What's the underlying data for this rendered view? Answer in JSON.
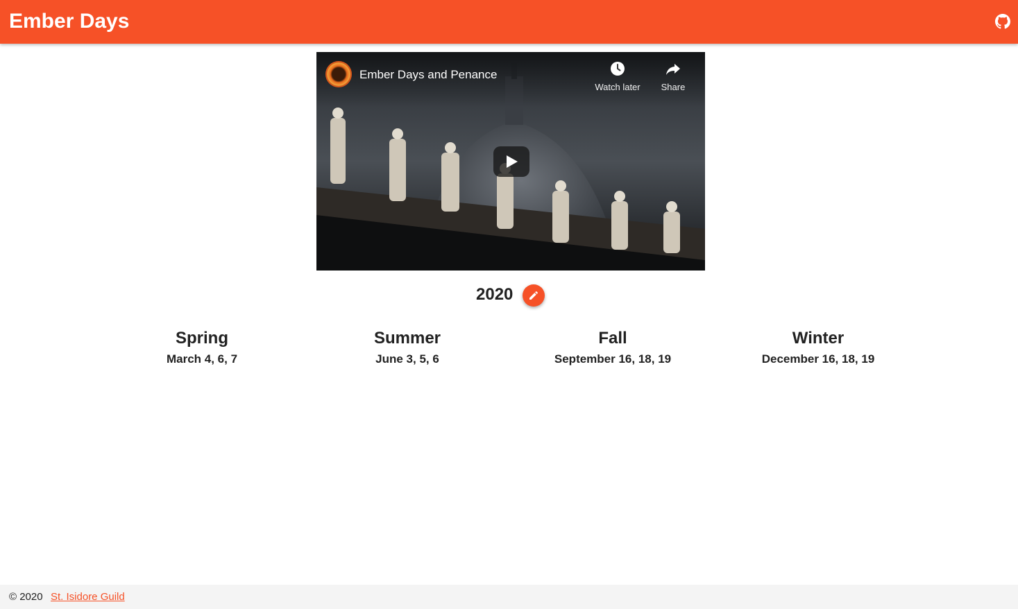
{
  "appbar": {
    "title": "Ember Days",
    "github_icon": "github-icon",
    "color": "#f65127"
  },
  "video": {
    "title": "Ember Days and Penance",
    "watch_later_label": "Watch later",
    "share_label": "Share",
    "icons": [
      "clock-icon",
      "share-arrow-icon",
      "play-icon",
      "channel-logo"
    ]
  },
  "year_selector": {
    "year": "2020",
    "edit_icon": "pencil-icon"
  },
  "seasons": [
    {
      "name": "Spring",
      "dates": "March 4, 6, 7"
    },
    {
      "name": "Summer",
      "dates": "June 3, 5, 6"
    },
    {
      "name": "Fall",
      "dates": "September 16, 18, 19"
    },
    {
      "name": "Winter",
      "dates": "December 16, 18, 19"
    }
  ],
  "footer": {
    "copyright": "© 2020",
    "link_text": "St. Isidore Guild",
    "link_color": "#f65127"
  }
}
